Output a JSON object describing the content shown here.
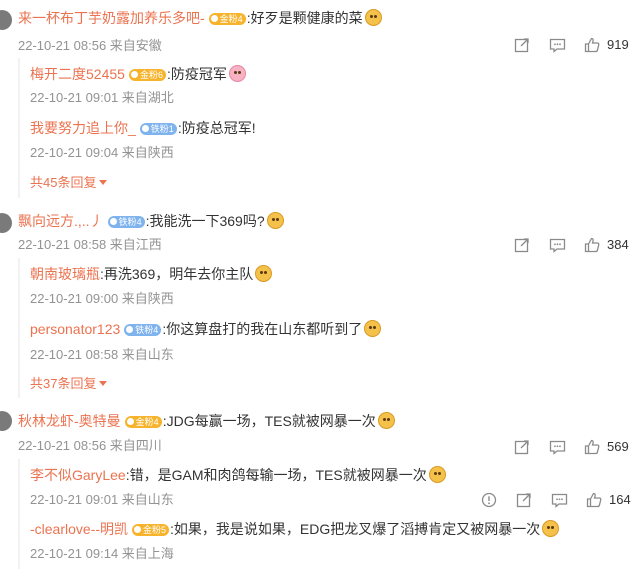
{
  "comments": [
    {
      "user": "来一杯布丁芋奶露加养乐多吧-",
      "badge": "金粉4",
      "badge_color": "gold",
      "text": ":好歹是颗健康的菜",
      "emoji": "doge",
      "meta": "22-10-21 08:56 来自安徽",
      "likes": "919",
      "replies": [
        {
          "user": "梅开二度52455",
          "badge": "金粉6",
          "badge_color": "gold",
          "text": ":防疫冠军",
          "emoji": "pig",
          "meta": "22-10-21 09:01 来自湖北"
        },
        {
          "user": "我要努力追上你_",
          "badge": "铁粉1",
          "badge_color": "blue",
          "text": ":防疫总冠军!",
          "emoji": "",
          "meta": "22-10-21 09:04 来自陕西"
        }
      ],
      "more": "共45条回复"
    },
    {
      "user": "飘向远方.,..丿",
      "badge": "铁粉4",
      "badge_color": "blue",
      "text": ":我能洗一下369吗?",
      "emoji": "doge",
      "meta": "22-10-21 08:58 来自江西",
      "likes": "384",
      "replies": [
        {
          "user": "朝南玻璃瓶",
          "badge": "",
          "badge_color": "",
          "text": ":再洗369，明年去你主队",
          "emoji": "doge",
          "meta": "22-10-21 09:00 来自陕西"
        },
        {
          "user": "personator123",
          "badge": "铁粉4",
          "badge_color": "blue",
          "text": ":你这算盘打的我在山东都听到了",
          "emoji": "doge",
          "meta": "22-10-21 08:58 来自山东"
        }
      ],
      "more": "共37条回复"
    },
    {
      "user": "秋林龙虾-奥特曼",
      "badge": "金粉4",
      "badge_color": "gold",
      "text": ":JDG每赢一场，TES就被网暴一次",
      "emoji": "doge",
      "meta": "22-10-21 08:56 来自四川",
      "likes": "569",
      "replies": [
        {
          "user": "李不似GaryLee",
          "badge": "",
          "badge_color": "",
          "text": ":错，是GAM和肉鸽每输一场，TES就被网暴一次",
          "emoji": "doge",
          "meta": "22-10-21 09:01 来自山东",
          "likes": "164"
        },
        {
          "user": "-clearlove--明凯",
          "badge": "金粉5",
          "badge_color": "gold",
          "text": ":如果，我是说如果，EDG把龙叉爆了滔搏肯定又被网暴一次",
          "emoji": "doge",
          "meta": "22-10-21 09:14 来自上海"
        }
      ],
      "more": ""
    }
  ]
}
